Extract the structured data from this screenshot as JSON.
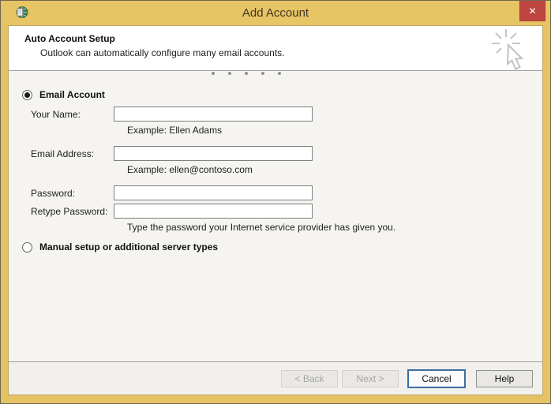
{
  "window": {
    "title": "Add Account",
    "close_glyph": "✕"
  },
  "header": {
    "title": "Auto Account Setup",
    "subtitle": "Outlook can automatically configure many email accounts."
  },
  "form": {
    "email_account_radio": {
      "label": "Email Account",
      "selected": true
    },
    "fields": [
      {
        "label": "Your Name:",
        "value": "",
        "hint": "Example: Ellen Adams"
      },
      {
        "label": "Email Address:",
        "value": "",
        "hint": "Example: ellen@contoso.com"
      },
      {
        "label": "Password:",
        "value": ""
      },
      {
        "label": "Retype Password:",
        "value": "",
        "hint": "Type the password your Internet service provider has given you."
      }
    ],
    "manual_radio": {
      "label": "Manual setup or additional server types",
      "selected": false
    }
  },
  "footer": {
    "buttons": [
      {
        "label": "< Back",
        "enabled": false
      },
      {
        "label": "Next >",
        "enabled": false
      },
      {
        "label": "Cancel",
        "enabled": true,
        "focused": true
      },
      {
        "label": "Help",
        "enabled": true
      }
    ]
  },
  "colors": {
    "titlebar": "#e7c464",
    "frame": "#e5c263",
    "close_button": "#bf4640",
    "focus_border": "#3c6e9f",
    "divider": "#9e9e9e",
    "main_bg": "#f5f4f0"
  }
}
